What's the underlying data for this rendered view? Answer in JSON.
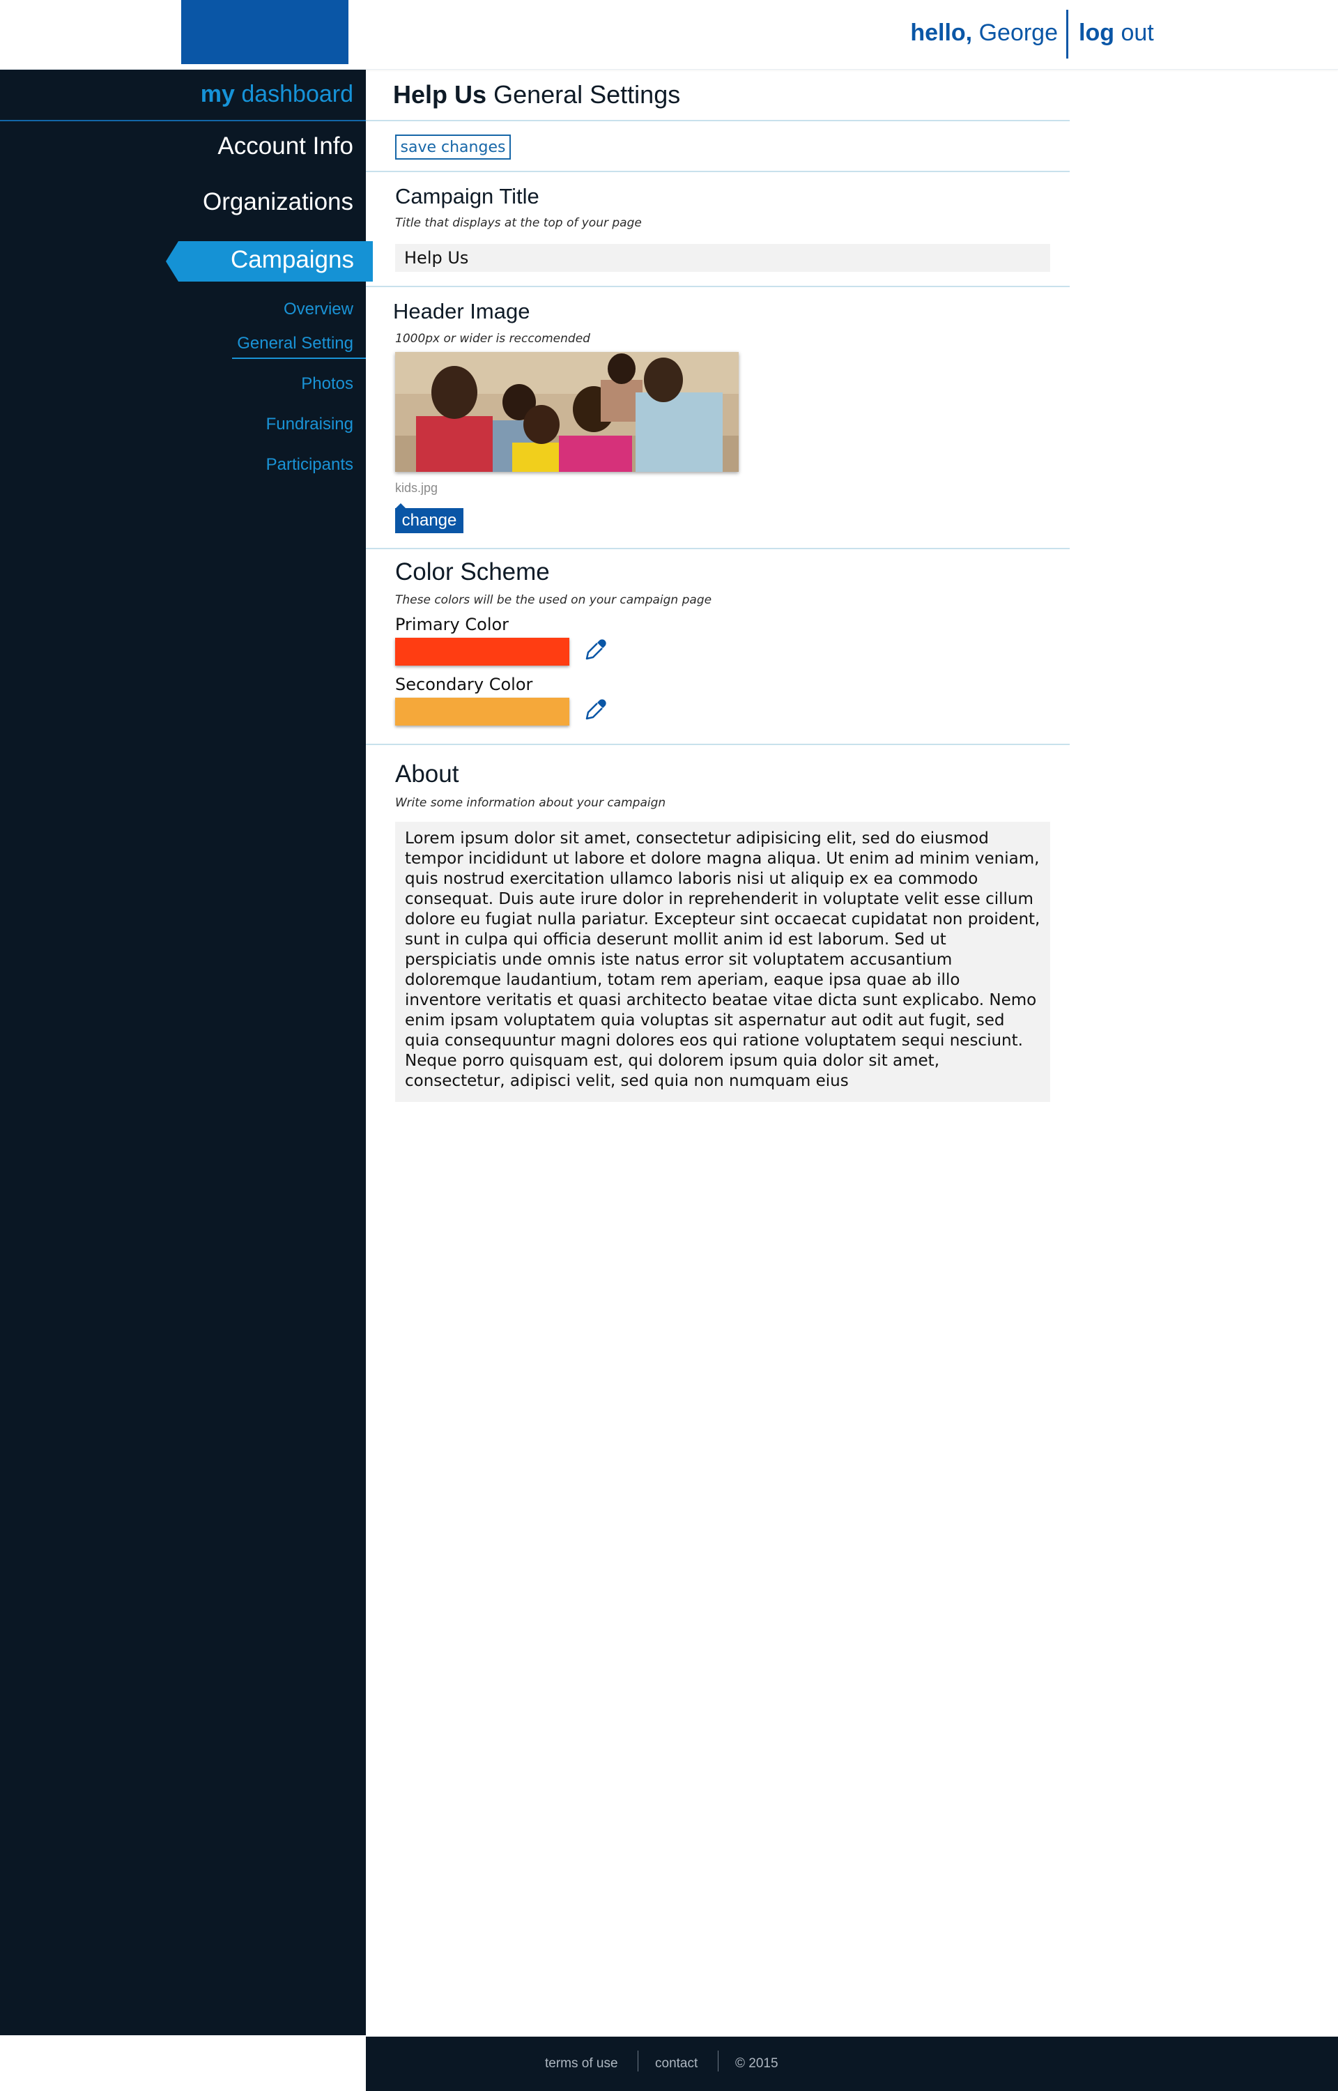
{
  "header": {
    "greeting": "hello,",
    "user_name": "George",
    "logout_strong": "log",
    "logout_rest": "out",
    "brand_color": "#0a56a6"
  },
  "sidebar": {
    "dashboard_strong": "my",
    "dashboard_rest": "dashboard",
    "items": [
      {
        "label": "Account Info"
      },
      {
        "label": "Organizations"
      },
      {
        "label": "Campaigns",
        "active": true
      }
    ],
    "subitems": [
      {
        "label": "Overview"
      },
      {
        "label": "General Setting",
        "active": true
      },
      {
        "label": "Photos"
      },
      {
        "label": "Fundraising"
      },
      {
        "label": "Participants"
      }
    ],
    "background": "#0a1724",
    "accent": "#1592d5"
  },
  "main": {
    "title_strong": "Help Us",
    "title_rest": "General Settings",
    "save_label": "save changes",
    "campaign_title": {
      "heading": "Campaign Title",
      "hint": "Title that displays at the top of your page",
      "value": "Help Us"
    },
    "header_image": {
      "heading": "Header Image",
      "hint": "1000px or wider is reccomended",
      "file_name": "kids.jpg",
      "change_label": "change"
    },
    "color_scheme": {
      "heading": "Color Scheme",
      "hint": "These colors will be the used on your campaign page",
      "primary_label": "Primary Color",
      "primary_value": "#ff3d12",
      "secondary_label": "Secondary Color",
      "secondary_value": "#f5a83a",
      "picker_icon": "eyedropper-icon"
    },
    "about": {
      "heading": "About",
      "hint": "Write some information about your campaign",
      "text": "Lorem ipsum dolor sit amet, consectetur adipisicing elit, sed do eiusmod tempor incididunt ut labore et dolore magna aliqua. Ut enim ad minim veniam, quis nostrud exercitation ullamco laboris nisi ut aliquip ex ea commodo consequat. Duis aute irure dolor in reprehenderit in voluptate velit esse cillum dolore eu fugiat nulla pariatur. Excepteur sint occaecat cupidatat non proident, sunt in culpa qui officia deserunt mollit anim id est laborum. Sed ut perspiciatis unde omnis iste natus error sit voluptatem accusantium doloremque laudantium, totam rem aperiam, eaque ipsa quae ab illo inventore veritatis et quasi architecto beatae vitae dicta sunt explicabo. Nemo enim ipsam voluptatem quia voluptas sit aspernatur aut odit aut fugit, sed quia consequuntur magni dolores eos qui ratione voluptatem sequi nesciunt. Neque porro quisquam est, qui dolorem ipsum quia dolor sit amet, consectetur, adipisci velit, sed quia non numquam eius"
    }
  },
  "footer": {
    "links": [
      "terms of use",
      "contact",
      "© 2015"
    ]
  }
}
